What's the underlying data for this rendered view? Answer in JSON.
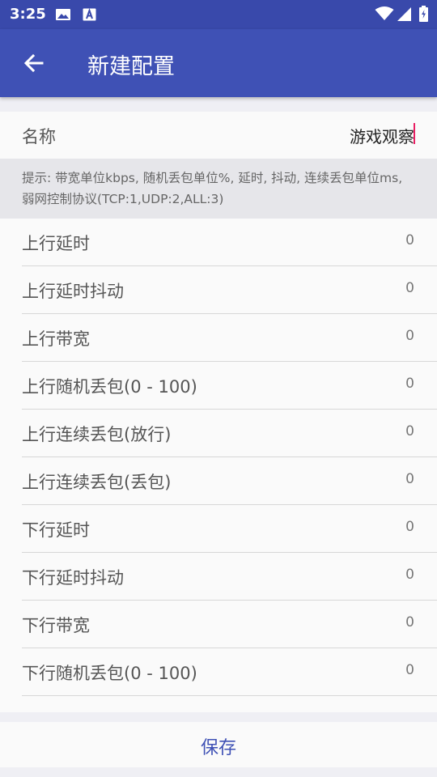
{
  "status_bar": {
    "time": "3:25"
  },
  "app_bar": {
    "title": "新建配置"
  },
  "name_field": {
    "label": "名称",
    "value": "游戏观察"
  },
  "hint": "提示: 带宽单位kbps, 随机丢包单位%, 延时, 抖动, 连续丢包单位ms, 弱网控制协议(TCP:1,UDP:2,ALL:3)",
  "items": [
    {
      "label": "上行延时",
      "value": "0"
    },
    {
      "label": "上行延时抖动",
      "value": "0"
    },
    {
      "label": "上行带宽",
      "value": "0"
    },
    {
      "label": "上行随机丢包(0 - 100)",
      "value": "0"
    },
    {
      "label": "上行连续丢包(放行)",
      "value": "0"
    },
    {
      "label": "上行连续丢包(丢包)",
      "value": "0"
    },
    {
      "label": "下行延时",
      "value": "0"
    },
    {
      "label": "下行延时抖动",
      "value": "0"
    },
    {
      "label": "下行带宽",
      "value": "0"
    },
    {
      "label": "下行随机丢包(0 - 100)",
      "value": "0"
    }
  ],
  "save_label": "保存",
  "colors": {
    "primary": "#3f51b5",
    "primary_dark": "#3949ab",
    "caret": "#e91e63"
  }
}
